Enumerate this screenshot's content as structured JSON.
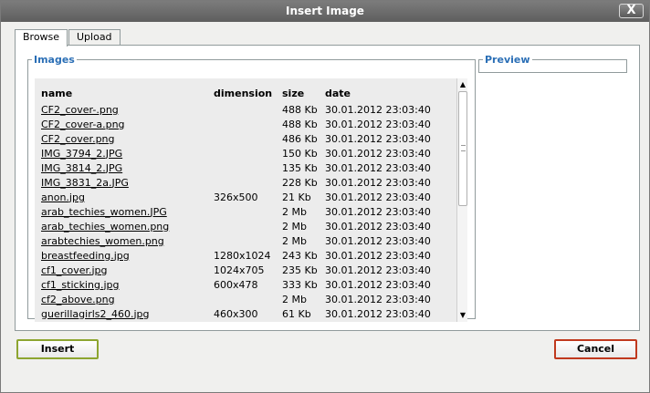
{
  "dialog": {
    "title": "Insert Image",
    "close_label": "X"
  },
  "tabs": [
    {
      "label": "Browse"
    },
    {
      "label": "Upload"
    }
  ],
  "images": {
    "legend": "Images",
    "columns": {
      "name": "name",
      "dimension": "dimension",
      "size": "size",
      "date": "date"
    },
    "rows": [
      {
        "name": "CF2_cover-.png",
        "dimension": "",
        "size": "488 Kb",
        "date": "30.01.2012 23:03:40"
      },
      {
        "name": "CF2_cover-a.png",
        "dimension": "",
        "size": "488 Kb",
        "date": "30.01.2012 23:03:40"
      },
      {
        "name": "CF2_cover.png",
        "dimension": "",
        "size": "486 Kb",
        "date": "30.01.2012 23:03:40"
      },
      {
        "name": "IMG_3794_2.JPG",
        "dimension": "",
        "size": "150 Kb",
        "date": "30.01.2012 23:03:40"
      },
      {
        "name": "IMG_3814_2.JPG",
        "dimension": "",
        "size": "135 Kb",
        "date": "30.01.2012 23:03:40"
      },
      {
        "name": "IMG_3831_2a.JPG",
        "dimension": "",
        "size": "228 Kb",
        "date": "30.01.2012 23:03:40"
      },
      {
        "name": "anon.jpg",
        "dimension": "326x500",
        "size": "21 Kb",
        "date": "30.01.2012 23:03:40"
      },
      {
        "name": "arab_techies_women.JPG",
        "dimension": "",
        "size": "2 Mb",
        "date": "30.01.2012 23:03:40"
      },
      {
        "name": "arab_techies_women.png",
        "dimension": "",
        "size": "2 Mb",
        "date": "30.01.2012 23:03:40"
      },
      {
        "name": "arabtechies_women.png",
        "dimension": "",
        "size": "2 Mb",
        "date": "30.01.2012 23:03:40"
      },
      {
        "name": "breastfeeding.jpg",
        "dimension": "1280x1024",
        "size": "243 Kb",
        "date": "30.01.2012 23:03:40"
      },
      {
        "name": "cf1_cover.jpg",
        "dimension": "1024x705",
        "size": "235 Kb",
        "date": "30.01.2012 23:03:40"
      },
      {
        "name": "cf1_sticking.jpg",
        "dimension": "600x478",
        "size": "333 Kb",
        "date": "30.01.2012 23:03:40"
      },
      {
        "name": "cf2_above.png",
        "dimension": "",
        "size": "2 Mb",
        "date": "30.01.2012 23:03:40"
      },
      {
        "name": "guerillagirls2_460.jpg",
        "dimension": "460x300",
        "size": "61 Kb",
        "date": "30.01.2012 23:03:40"
      }
    ]
  },
  "preview": {
    "legend": "Preview"
  },
  "buttons": {
    "insert": "Insert",
    "cancel": "Cancel"
  }
}
